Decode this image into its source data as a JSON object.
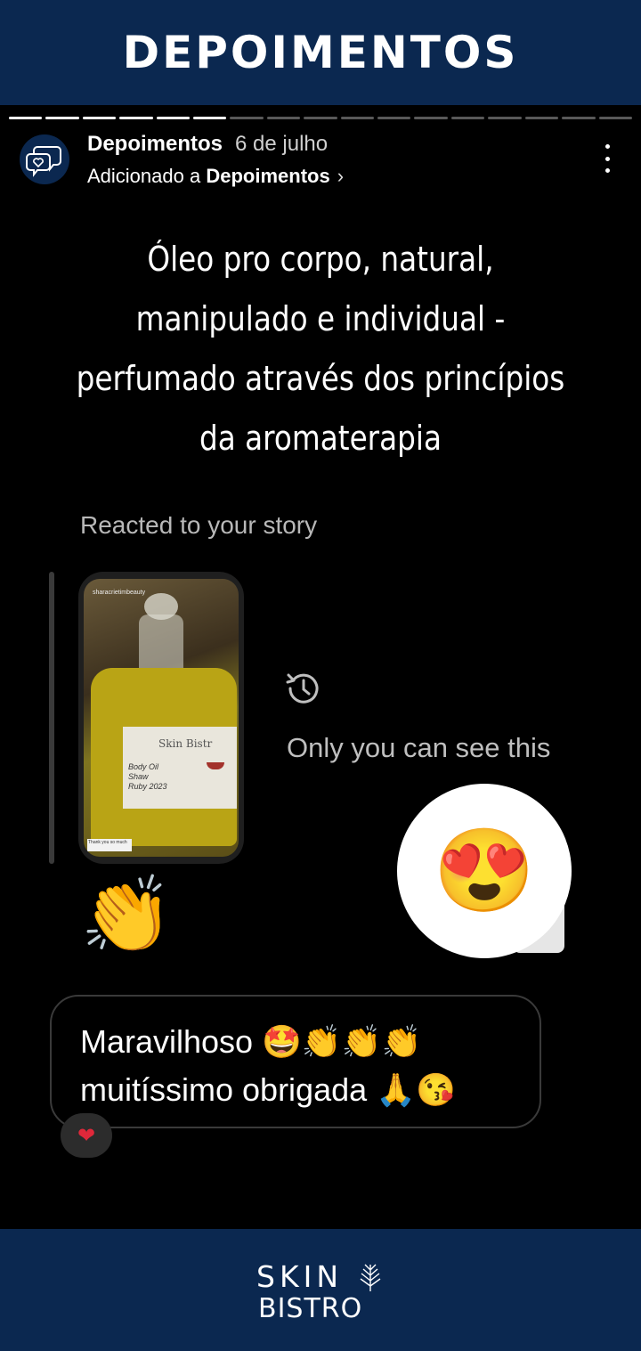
{
  "banner": {
    "title": "DEPOIMENTOS"
  },
  "story": {
    "progress_total": 17,
    "progress_done": 6,
    "account_name": "Depoimentos",
    "date": "6 de julho",
    "added_prefix": "Adicionado a",
    "added_highlight": "Depoimentos",
    "chevron": "›",
    "more_icon": "more-vert-icon",
    "caption_lines": [
      "Óleo pro corpo, natural,",
      "manipulado  e individual -",
      "perfumado através dos princípios",
      "da aromaterapia"
    ]
  },
  "screenshot": {
    "reacted_text": "Reacted to your story",
    "thumb_handle": "sharacrietimbeauty",
    "bottle_brand": "Skin Bistr",
    "bottle_script": [
      "Body Oil",
      "Shaw",
      "Ruby 2023"
    ],
    "thumb_note": "Thank you so much",
    "only_you_text": "Only you can see this",
    "reaction_emoji": "😍",
    "clap_emoji": "👏",
    "reply_line1": "Maravilhoso 🤩👏👏👏",
    "reply_line2": "muitíssimo obrigada 🙏😘",
    "heart": "❤"
  },
  "footer": {
    "logo_line1": "SKIN",
    "logo_line2": "BISTRO"
  },
  "colors": {
    "navy": "#0b2850",
    "background": "#000000",
    "heart": "#e0283a"
  }
}
